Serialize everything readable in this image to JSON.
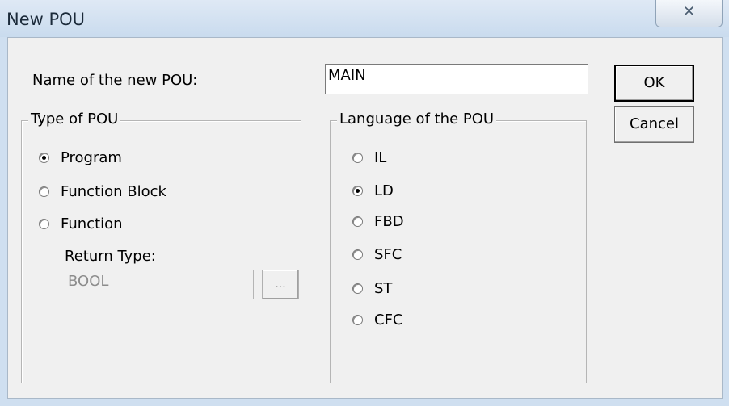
{
  "window": {
    "title": "New POU",
    "close_glyph": "✕"
  },
  "name_field": {
    "label": "Name of the new POU:",
    "value": "MAIN"
  },
  "buttons": {
    "ok": "OK",
    "cancel": "Cancel",
    "browse": "..."
  },
  "type_group": {
    "title": "Type of POU",
    "options": [
      "Program",
      "Function Block",
      "Function"
    ],
    "selected": "Program",
    "return_type_label": "Return Type:",
    "return_type_value": "BOOL"
  },
  "language_group": {
    "title": "Language of the POU",
    "options": [
      "IL",
      "LD",
      "FBD",
      "SFC",
      "ST",
      "CFC"
    ],
    "selected": "LD"
  }
}
